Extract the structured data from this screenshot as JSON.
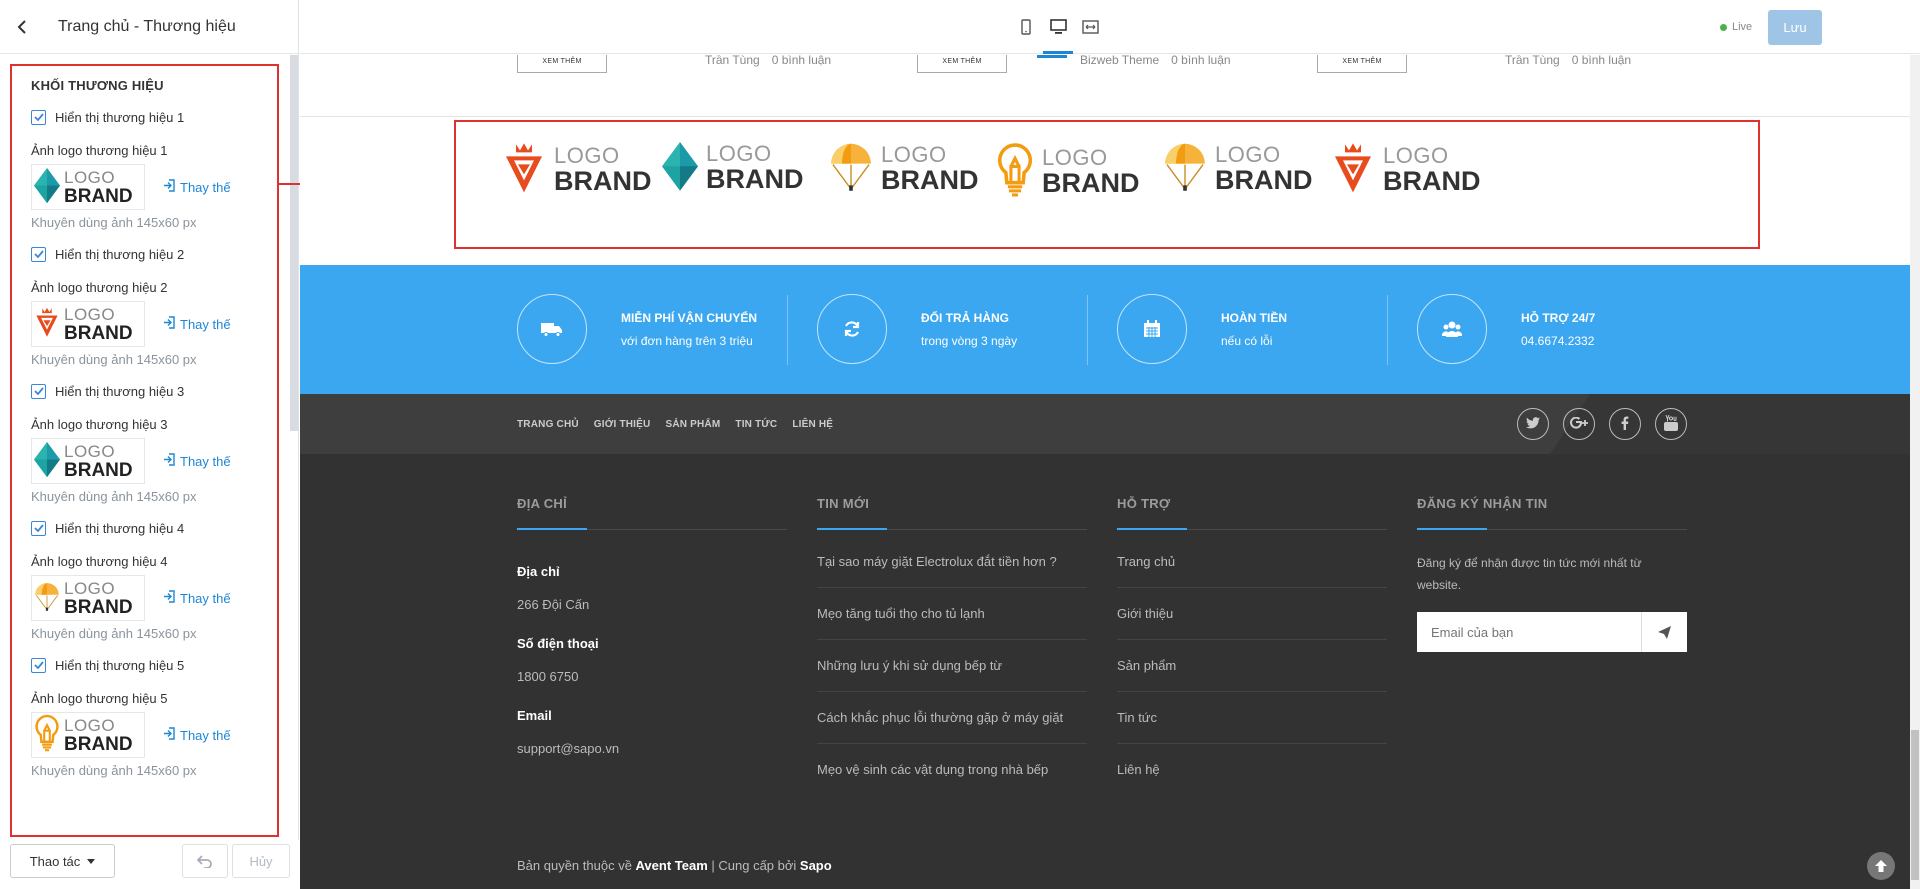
{
  "editor": {
    "title": "Trang chủ - Thương hiệu",
    "section_title": "KHỐI THƯƠNG HIỆU",
    "brands": [
      {
        "toggle_label": "Hiển thị thương hiệu 1",
        "image_label": "Ảnh logo thương hiệu 1",
        "logo_icon": "kite-icon",
        "replace": "Thay thế",
        "hint": "Khuyên dùng ảnh 145x60 px"
      },
      {
        "toggle_label": "Hiển thị thương hiệu 2",
        "image_label": "Ảnh logo thương hiệu 2",
        "logo_icon": "diamond-crown-icon",
        "replace": "Thay thế",
        "hint": "Khuyên dùng ảnh 145x60 px"
      },
      {
        "toggle_label": "Hiển thị thương hiệu 3",
        "image_label": "Ảnh logo thương hiệu 3",
        "logo_icon": "kite-icon",
        "replace": "Thay thế",
        "hint": "Khuyên dùng ảnh 145x60 px"
      },
      {
        "toggle_label": "Hiển thị thương hiệu 4",
        "image_label": "Ảnh logo thương hiệu 4",
        "logo_icon": "parachute-icon",
        "replace": "Thay thế",
        "hint": "Khuyên dùng ảnh 145x60 px"
      },
      {
        "toggle_label": "Hiển thị thương hiệu 5",
        "image_label": "Ảnh logo thương hiệu 5",
        "logo_icon": "lightbulb-icon",
        "replace": "Thay thế",
        "hint": "Khuyên dùng ảnh 145x60 px"
      }
    ],
    "logo_text_top": "LOGO",
    "logo_text_bottom": "BRAND",
    "actions_label": "Thao tác",
    "redo_label": "Hủy"
  },
  "topbar": {
    "live_label": "Live",
    "save_label": "Lưu"
  },
  "blog_strip": {
    "button_label": "XEM THÊM",
    "posts": [
      {
        "author": "Trần Tùng",
        "comments": "0 bình luận"
      },
      {
        "author": "Bizweb Theme",
        "comments": "0 bình luận"
      },
      {
        "author": "Trần Tùng",
        "comments": "0 bình luận"
      }
    ]
  },
  "brands_row": {
    "logo_top": "LOGO",
    "logo_bottom": "BRAND",
    "logos": [
      "diamond-crown-icon",
      "kite-icon",
      "parachute-icon",
      "lightbulb-icon",
      "parachute-icon",
      "diamond-crown-icon"
    ]
  },
  "features": [
    {
      "icon": "truck-icon",
      "title": "MIỄN PHÍ VẬN CHUYỂN",
      "sub": "với đơn hàng trên 3 triệu"
    },
    {
      "icon": "refresh-icon",
      "title": "ĐỔI TRẢ HÀNG",
      "sub": "trong vòng 3 ngày"
    },
    {
      "icon": "calendar-icon",
      "title": "HOÀN TIỀN",
      "sub": "nếu có lỗi"
    },
    {
      "icon": "users-icon",
      "title": "HỖ TRỢ 24/7",
      "sub": "04.6674.2332"
    }
  ],
  "footer_nav": [
    "TRANG CHỦ",
    "GIỚI THIỆU",
    "SẢN PHẨM",
    "TIN TỨC",
    "LIÊN HỆ"
  ],
  "social": [
    "twitter-icon",
    "google-plus-icon",
    "facebook-icon",
    "youtube-icon"
  ],
  "footer": {
    "address": {
      "title": "ĐỊA CHỈ",
      "addr_label": "Địa chỉ",
      "addr_value": "266 Đội Cấn",
      "phone_label": "Số điện thoại",
      "phone_value": "1800 6750",
      "email_label": "Email",
      "email_value": "support@sapo.vn"
    },
    "news": {
      "title": "TIN MỚI",
      "items": [
        "Tại sao máy giặt Electrolux đắt tiền hơn ?",
        "Mẹo tăng tuổi thọ cho tủ lạnh",
        "Những lưu ý khi sử dụng bếp từ",
        "Cách khắc phục lỗi thường gặp ở máy giặt",
        "Mẹo vệ sinh các vật dụng trong nhà bếp"
      ]
    },
    "support": {
      "title": "HỖ TRỢ",
      "items": [
        "Trang chủ",
        "Giới thiệu",
        "Sản phẩm",
        "Tin tức",
        "Liên hệ"
      ]
    },
    "newsletter": {
      "title": "ĐĂNG KÝ NHẬN TIN",
      "text": "Đăng ký để nhận được tin tức mới nhất từ website.",
      "placeholder": "Email của bạn"
    },
    "copyright_prefix": "Bản quyền thuộc về ",
    "copyright_owner": "Avent Team",
    "copyright_mid": " | Cung cấp bởi ",
    "copyright_provider": "Sapo"
  },
  "colors": {
    "accent": "#1d87d6",
    "feature_bg": "#3aa7f0",
    "highlight_border": "#e03131",
    "footer_bg": "#323232"
  }
}
